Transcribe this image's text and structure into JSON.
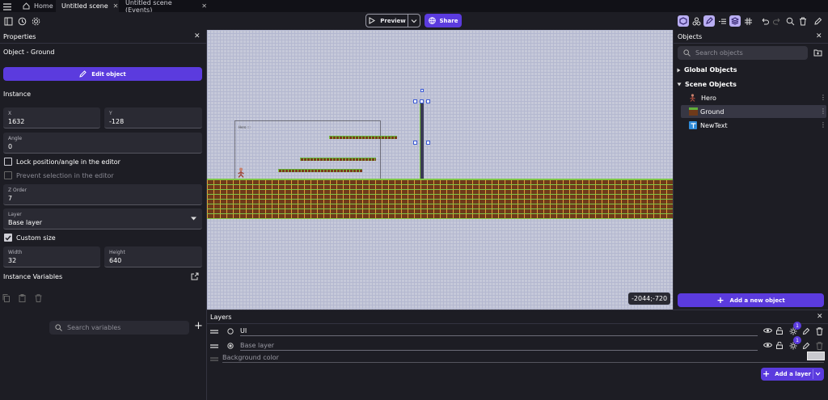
{
  "tabs": [
    {
      "label": "Home"
    },
    {
      "label": "Untitled scene"
    },
    {
      "label": "Untitled scene (Events)"
    }
  ],
  "toolbar": {
    "preview_label": "Preview",
    "share_label": "Share"
  },
  "properties": {
    "title": "Properties",
    "object_line": "Object  - Ground",
    "edit_object_label": "Edit object",
    "instance_heading": "Instance",
    "x_label": "X",
    "x_value": "1632",
    "y_label": "Y",
    "y_value": "-128",
    "angle_label": "Angle",
    "angle_value": "0",
    "lock_label": "Lock position/angle in the editor",
    "prevent_label": "Prevent selection in the editor",
    "zorder_label": "Z Order",
    "zorder_value": "7",
    "layer_label": "Layer",
    "layer_value": "Base layer",
    "custom_size_label": "Custom size",
    "width_label": "Width",
    "width_value": "32",
    "height_label": "Height",
    "height_value": "640",
    "instance_vars_heading": "Instance Variables",
    "search_vars_placeholder": "Search variables"
  },
  "scene": {
    "coords": "-2044;-720",
    "tiny_label": "Hero :::"
  },
  "objects": {
    "title": "Objects",
    "search_placeholder": "Search objects",
    "global_heading": "Global Objects",
    "scene_heading": "Scene Objects",
    "items": [
      {
        "label": "Hero"
      },
      {
        "label": "Ground"
      },
      {
        "label": "NewText"
      }
    ],
    "add_label": "Add a new object"
  },
  "layers": {
    "title": "Layers",
    "items": [
      {
        "label": "UI",
        "effects": "1"
      },
      {
        "label": "Base layer",
        "effects": "1"
      }
    ],
    "background_label": "Background color",
    "add_label": "Add a layer"
  },
  "colors": {
    "accent": "#5b3bde",
    "panel_bg": "#1d1d24",
    "scene_bg": "#c6c9d9"
  }
}
